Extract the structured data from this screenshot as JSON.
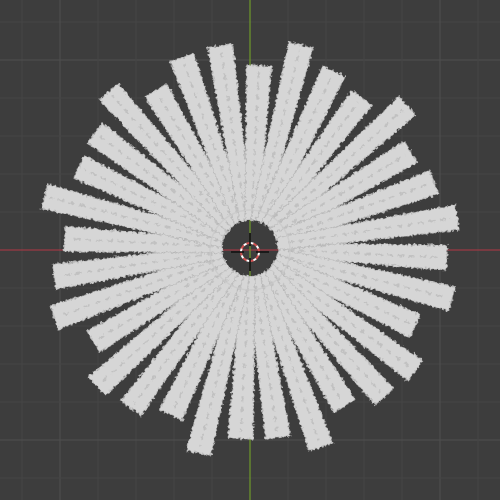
{
  "viewport": {
    "background_color": "#3d3d3d",
    "grid": {
      "visible": true,
      "minor_line_color": "#454545",
      "major_line_color": "#4e4e4e"
    },
    "axes": {
      "x_axis_color": "#9d3a44",
      "y_axis_color": "#6f9a2a"
    }
  },
  "object": {
    "kind": "radial hair strands",
    "strand_count": 32,
    "strand_color": "#d6d6d6",
    "strand_shadow_color": "#b9b9b9",
    "selected": false
  },
  "cursor_3d": {
    "icon": "3d-cursor-icon",
    "ring_colors": [
      "#d05050",
      "#ffffff"
    ]
  }
}
